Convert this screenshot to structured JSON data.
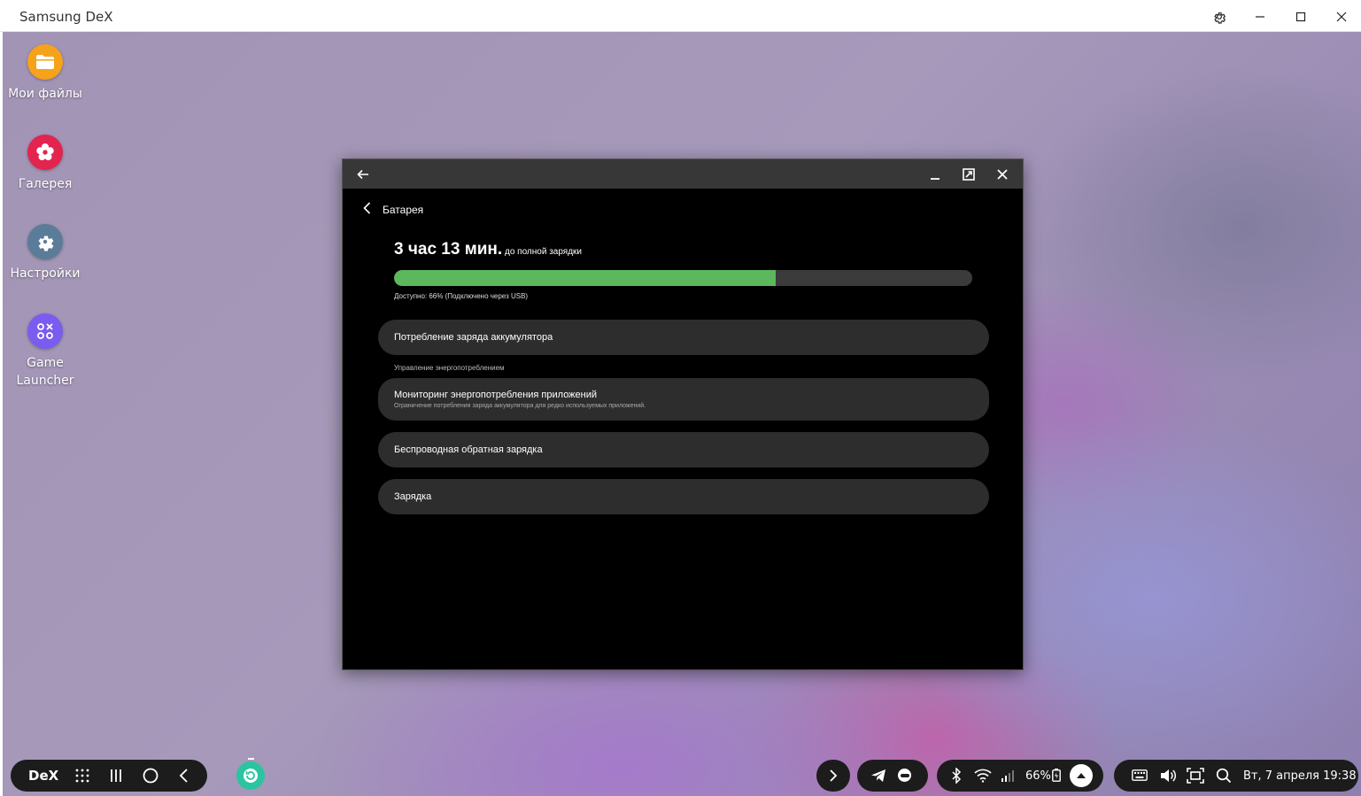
{
  "host": {
    "title": "Samsung DeX"
  },
  "desktop_icons": [
    {
      "label": "Мои файлы",
      "color": "#f7a21b"
    },
    {
      "label": "Галерея",
      "color": "#e2244f"
    },
    {
      "label": "Настройки",
      "color": "#5b7c99"
    },
    {
      "label_line1": "Game",
      "label_line2": "Launcher",
      "color": "#7a5cf0"
    }
  ],
  "window": {
    "header_title": "Батарея",
    "eta_time": "3 час 13 мин.",
    "eta_suffix": " до полной зарядки",
    "battery_level": 0.66,
    "available_text": "Доступно: 66% (Подключено через USB)",
    "bar_color": "#5cb85c",
    "items": [
      {
        "label": "Потребление заряда аккумулятора"
      },
      {
        "label": "Мониторинг энергопотребления приложений",
        "sub": "Ограничение потребления заряда аккумулятора для редко используемых приложений."
      },
      {
        "label": "Беспроводная обратная зарядка"
      },
      {
        "label": "Зарядка"
      }
    ],
    "section_label": "Управление энергопотреблением"
  },
  "taskbar": {
    "dex_label": "DeX",
    "battery_percent": "66%",
    "datetime": "Вт, 7 апреля 19:38",
    "refresh_color": "#2bc4a0"
  }
}
